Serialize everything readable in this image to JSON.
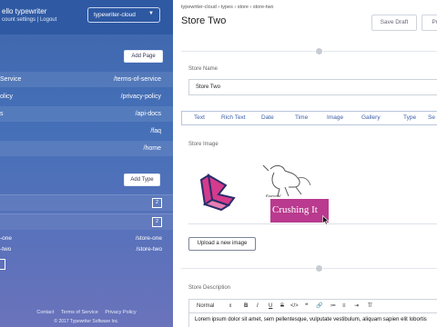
{
  "sidebar": {
    "greeting": "ello typewriter",
    "account_links": [
      "count settings",
      "Logout"
    ],
    "link_separator": "|",
    "project": "typewriter-cloud",
    "add_page": "Add Page",
    "pages": [
      {
        "left": " Service",
        "right": "/terms-of-service"
      },
      {
        "left": "olicy",
        "right": "/privacy-policy"
      },
      {
        "left": "s",
        "right": "/api-docs"
      },
      {
        "left": "",
        "right": "/faq"
      },
      {
        "left": "",
        "right": "/home"
      }
    ],
    "add_type": "Add Type",
    "type_counts": [
      "2",
      "2"
    ],
    "stores": [
      {
        "left": "-one",
        "right": "/store-one"
      },
      {
        "left": "-two",
        "right": "/store-two"
      }
    ],
    "footer_links": [
      "Contact",
      "Terms of Service",
      "Privacy Policy"
    ],
    "copyright": "© 2017 Typewriter Software Inc."
  },
  "main": {
    "breadcrumb": "typewriter-cloud  ›  types  ›  store  ›  store-two",
    "title": "Store Two",
    "save_draft": "Save Draft",
    "publish": "Pu",
    "name_label": "Store Name",
    "name_value": "Store Two",
    "tabs": [
      "Text",
      "Rich Text",
      "Date",
      "Time",
      "Image",
      "Gallery",
      "Type",
      "Se"
    ],
    "image_label": "Store Image",
    "image_caption_small": "Essential",
    "image_caption": "Crushing It",
    "upload": "Upload a new image",
    "desc_label": "Store Description",
    "toolbar": {
      "format": "Normal",
      "buttons": [
        "B",
        "I",
        "U",
        "S",
        "</>",
        "❝",
        "🔗",
        "≔",
        "≡",
        "⇥",
        "T̸"
      ]
    },
    "body_text": "Lorem ipsum dolor sit amet, sem pellentesque, vulputate vestibulum, aliquam sapien elit lobortis"
  },
  "colors": {
    "sidebar_top": "#2f5aa3",
    "sidebar_bottom": "#6a73bb",
    "tab_text": "#3b5fa8",
    "logo_accent": "#d43b8c",
    "crushing_badge": "#b93a8e"
  },
  "icons": {
    "project_chevron": "chevron-down-icon",
    "section_dot": "dot-icon",
    "cursor": "mouse-pointer-icon"
  }
}
